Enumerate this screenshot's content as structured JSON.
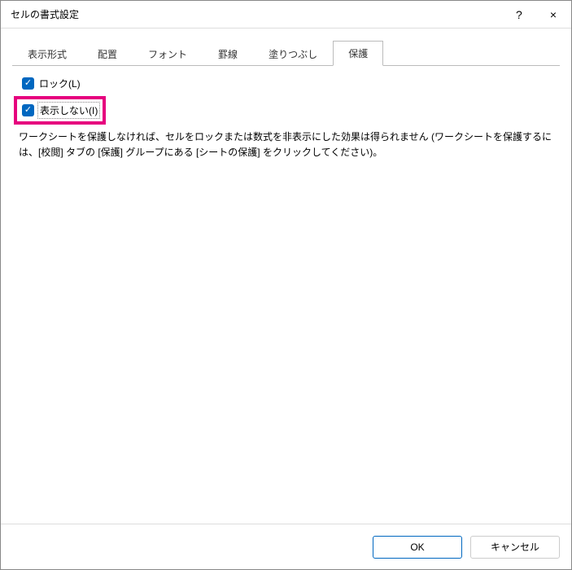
{
  "title": "セルの書式設定",
  "titlebar": {
    "help_label": "?",
    "close_label": "×"
  },
  "tabs": [
    {
      "label": "表示形式"
    },
    {
      "label": "配置"
    },
    {
      "label": "フォント"
    },
    {
      "label": "罫線"
    },
    {
      "label": "塗りつぶし"
    },
    {
      "label": "保護"
    }
  ],
  "active_tab_index": 5,
  "protection": {
    "lock_label": "ロック(L)",
    "hidden_label": "表示しない(I)",
    "description": "ワークシートを保護しなければ、セルをロックまたは数式を非表示にした効果は得られません (ワークシートを保護するには、[校閲] タブの [保護] グループにある [シートの保護] をクリックしてください)。"
  },
  "buttons": {
    "ok_label": "OK",
    "cancel_label": "キャンセル"
  }
}
